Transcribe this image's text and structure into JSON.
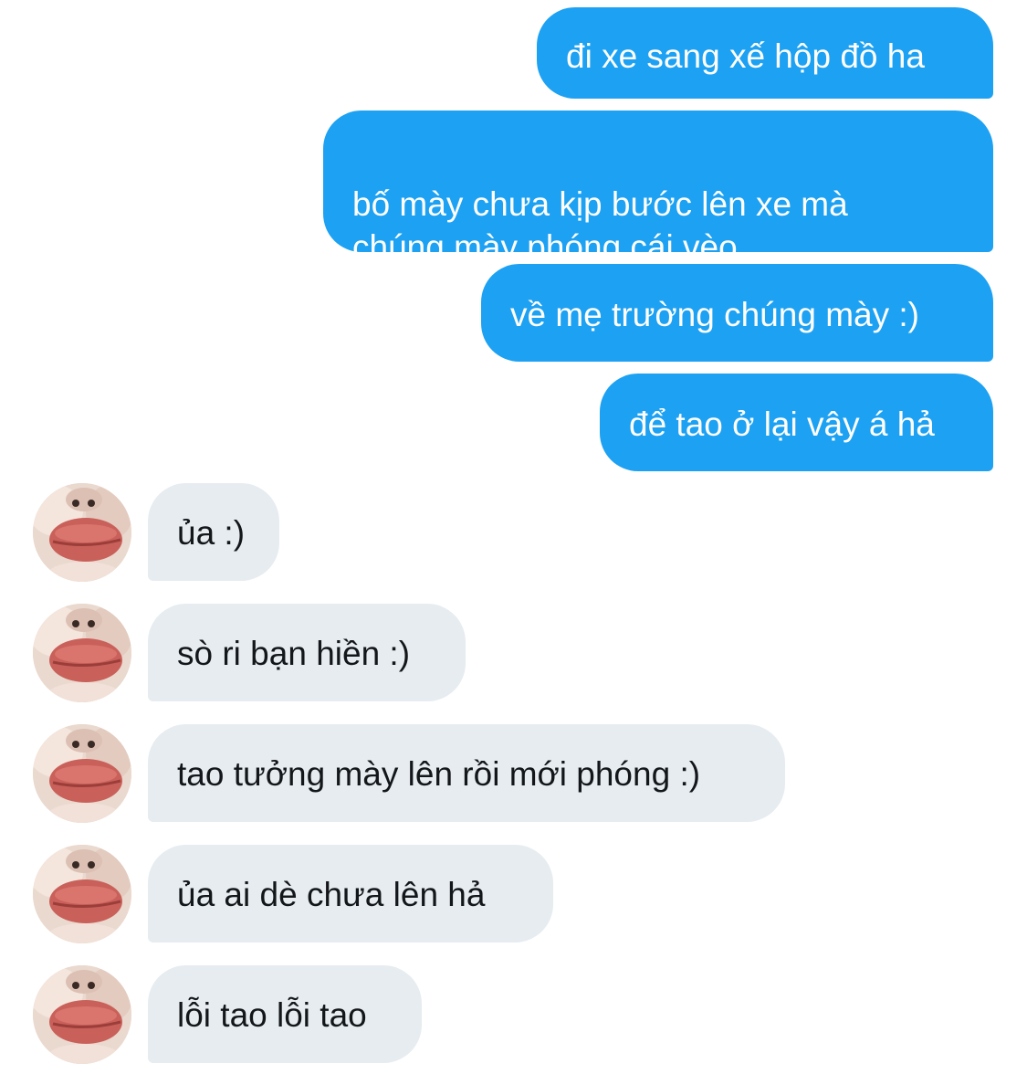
{
  "conversation": {
    "sent_messages": [
      "đi xe sang xế hộp đồ ha",
      "bố mày chưa kịp bước lên xe mà\nchúng mày phóng cái vèo",
      "về mẹ trường chúng mày :)",
      "để tao ở lại vậy á hả"
    ],
    "received_messages": [
      "ủa :)",
      "sò ri bạn hiền :)",
      "tao tưởng mày lên rồi mới phóng :)",
      "ủa ai dè chưa lên hả",
      "lỗi tao lỗi tao"
    ],
    "avatar_icon": "lips-photo-avatar",
    "colors": {
      "sent_bubble": "#1da1f2",
      "received_bubble": "#e6ecf0",
      "sent_text": "#ffffff",
      "received_text": "#14171a"
    }
  }
}
